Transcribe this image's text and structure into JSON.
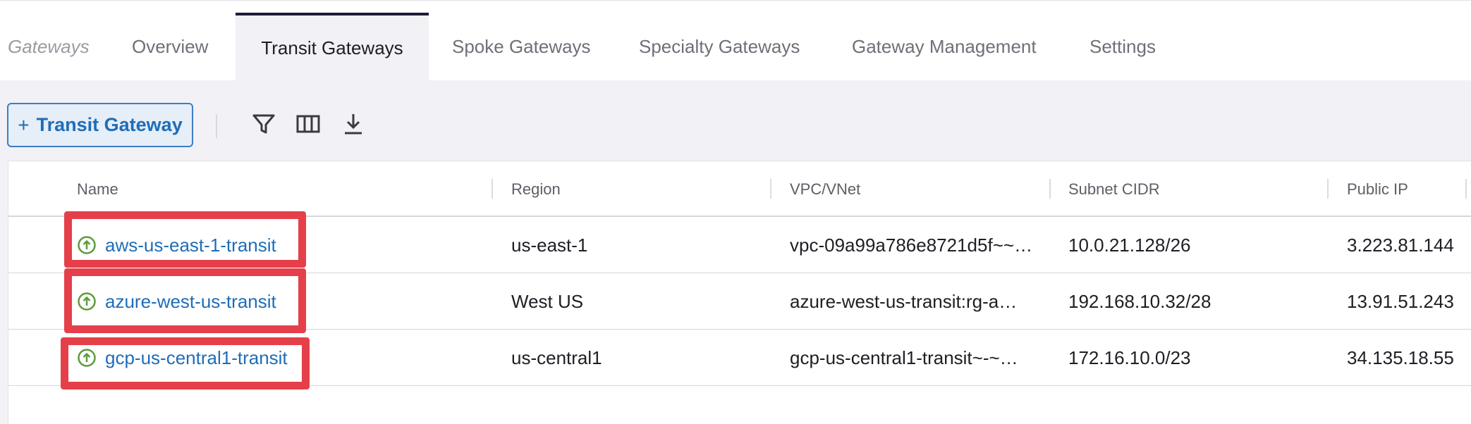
{
  "tabs": {
    "section_label": "Gateways",
    "items": [
      {
        "label": "Overview"
      },
      {
        "label": "Transit Gateways"
      },
      {
        "label": "Spoke Gateways"
      },
      {
        "label": "Specialty Gateways"
      },
      {
        "label": "Gateway Management"
      },
      {
        "label": "Settings"
      }
    ],
    "active": "Transit Gateways"
  },
  "toolbar": {
    "add_button_plus": "+",
    "add_button_label": "Transit Gateway",
    "icons": [
      "filter-icon",
      "columns-icon",
      "download-icon"
    ]
  },
  "table": {
    "columns": [
      "Name",
      "Region",
      "VPC/VNet",
      "Subnet CIDR",
      "Public IP"
    ],
    "rows": [
      {
        "name": "aws-us-east-1-transit",
        "region": "us-east-1",
        "vpc": "vpc-09a99a786e8721d5f~~…",
        "subnet": "10.0.21.128/26",
        "public_ip": "3.223.81.144",
        "status_icon": "status-up-icon"
      },
      {
        "name": "azure-west-us-transit",
        "region": "West US",
        "vpc": "azure-west-us-transit:rg-a…",
        "subnet": "192.168.10.32/28",
        "public_ip": "13.91.51.243",
        "status_icon": "status-up-icon"
      },
      {
        "name": "gcp-us-central1-transit",
        "region": "us-central1",
        "vpc": "gcp-us-central1-transit~-~…",
        "subnet": "172.16.10.0/23",
        "public_ip": "34.135.18.55",
        "status_icon": "status-up-icon"
      }
    ]
  },
  "colors": {
    "accent": "#1f6db8",
    "status_ok": "#5f9a3c",
    "highlight": "#e5404a",
    "active_tab_border": "#1f1b3a"
  }
}
